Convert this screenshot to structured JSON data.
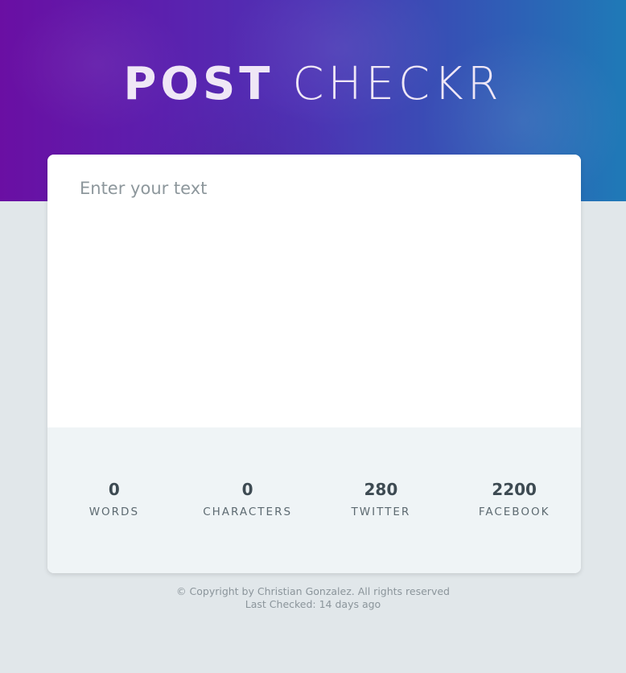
{
  "header": {
    "title_bold": "POST",
    "title_light": "CHECKR"
  },
  "editor": {
    "placeholder": "Enter your text",
    "value": ""
  },
  "stats": [
    {
      "value": "0",
      "label": "WORDS"
    },
    {
      "value": "0",
      "label": "CHARACTERS"
    },
    {
      "value": "280",
      "label": "TWITTER"
    },
    {
      "value": "2200",
      "label": "FACEBOOK"
    }
  ],
  "footer": {
    "copyright": "© Copyright by Christian Gonzalez. All rights reserved",
    "last_checked": "Last Checked: 14 days ago"
  },
  "colors": {
    "hero_gradient_start": "#6a0fa3",
    "hero_gradient_end": "#1f7ab7",
    "page_background": "#e1e7ea",
    "card_background": "#ffffff",
    "stats_background": "#eff4f6"
  }
}
